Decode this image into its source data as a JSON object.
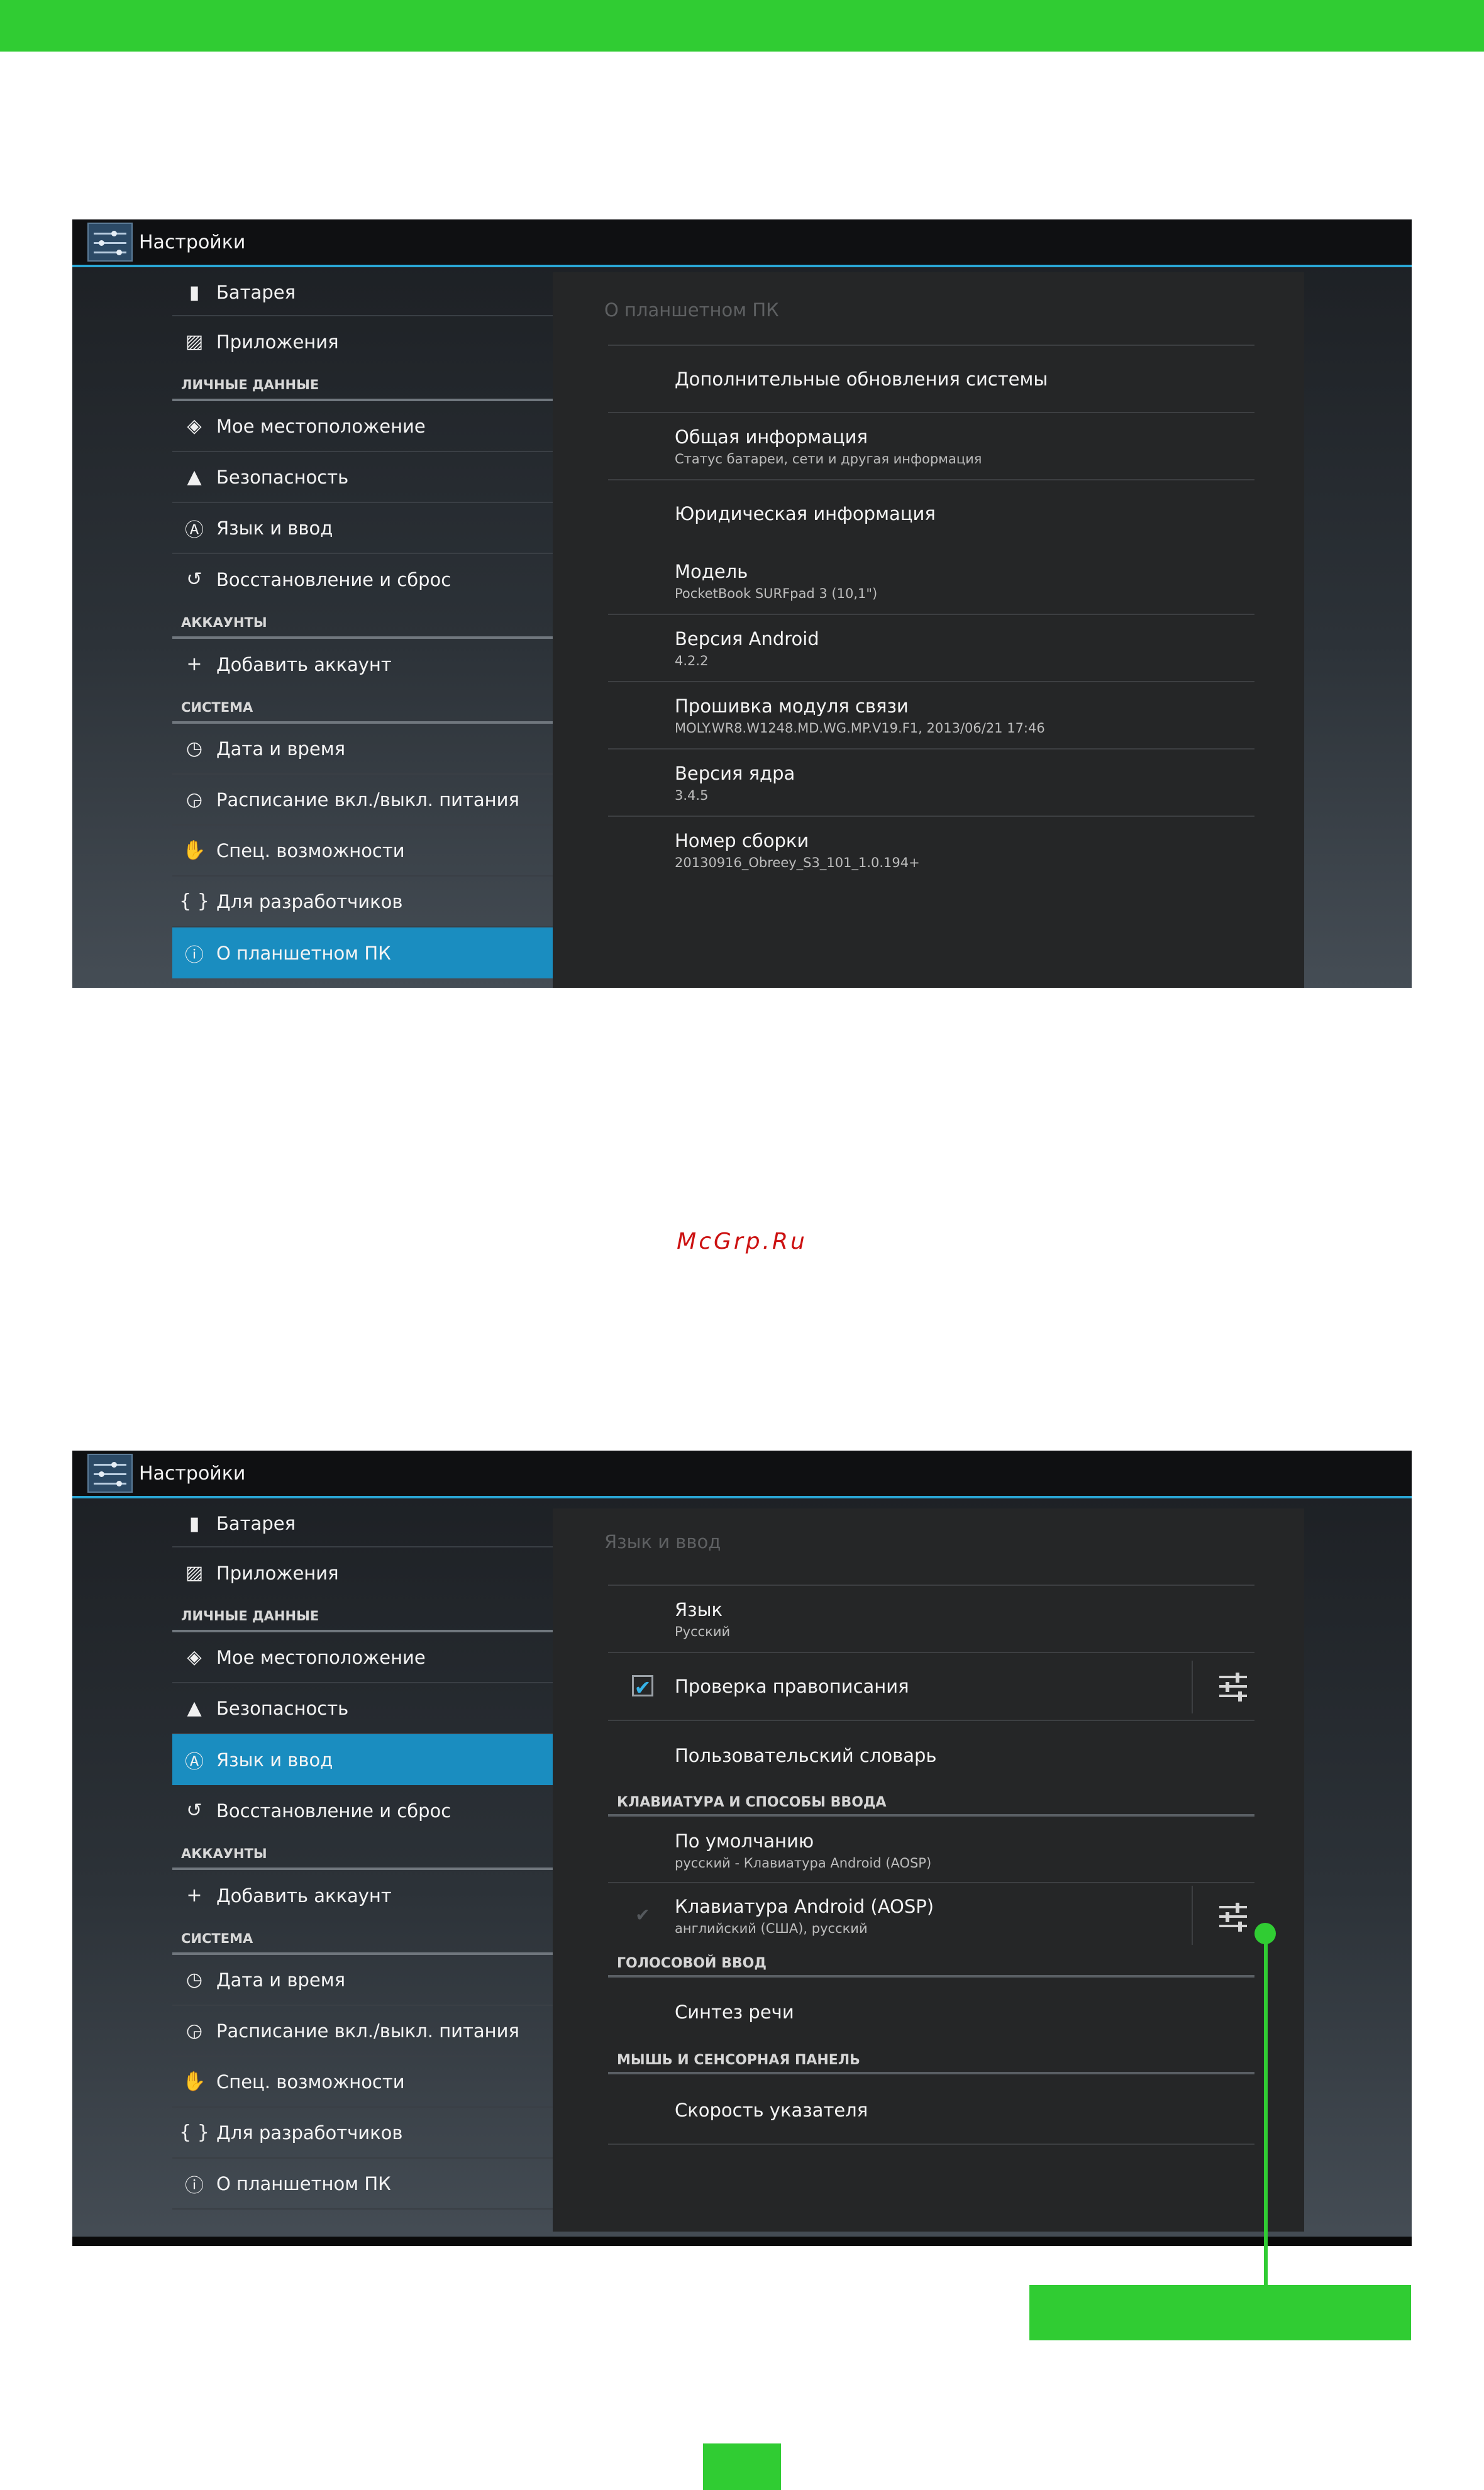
{
  "colors": {
    "accent_green": "#30cc33",
    "holo_blue": "#2aa7d6",
    "active_item": "#1a8dc0",
    "watermark": "#cc1111"
  },
  "watermark": "McGrp.Ru",
  "screen1": {
    "app_title": "Настройки",
    "sidebar": {
      "battery": "Батарея",
      "apps": "Приложения",
      "personal_header": "ЛИЧНЫЕ ДАННЫЕ",
      "location": "Мое местоположение",
      "security": "Безопасность",
      "language": "Язык и ввод",
      "backup": "Восстановление и сброс",
      "accounts_header": "АККАУНТЫ",
      "add_account": "Добавить аккаунт",
      "system_header": "СИСТЕМА",
      "datetime": "Дата и время",
      "schedule": "Расписание вкл./выкл. питания",
      "accessibility": "Спец. возможности",
      "developer": "Для разработчиков",
      "about": "О планшетном ПК",
      "active_item": "О планшетном ПК"
    },
    "panel": {
      "title": "О планшетном ПК",
      "rows": [
        {
          "title": "Дополнительные обновления системы",
          "subtitle": ""
        },
        {
          "title": "Общая информация",
          "subtitle": "Статус батареи, сети и другая информация"
        },
        {
          "title": "Юридическая информация",
          "subtitle": ""
        },
        {
          "title": "Модель",
          "subtitle": "PocketBook SURFpad 3 (10,1\")"
        },
        {
          "title": "Версия Android",
          "subtitle": "4.2.2"
        },
        {
          "title": "Прошивка модуля связи",
          "subtitle": "MOLY.WR8.W1248.MD.WG.MP.V19.F1, 2013/06/21 17:46"
        },
        {
          "title": "Версия ядра",
          "subtitle": "3.4.5"
        },
        {
          "title": "Номер сборки",
          "subtitle": "20130916_Obreey_S3_101_1.0.194+"
        }
      ]
    }
  },
  "screen2": {
    "app_title": "Настройки",
    "sidebar": {
      "battery": "Батарея",
      "apps": "Приложения",
      "personal_header": "ЛИЧНЫЕ ДАННЫЕ",
      "location": "Мое местоположение",
      "security": "Безопасность",
      "language": "Язык и ввод",
      "backup": "Восстановление и сброс",
      "accounts_header": "АККАУНТЫ",
      "add_account": "Добавить аккаунт",
      "system_header": "СИСТЕМА",
      "datetime": "Дата и время",
      "schedule": "Расписание вкл./выкл. питания",
      "accessibility": "Спец. возможности",
      "developer": "Для разработчиков",
      "about": "О планшетном ПК",
      "active_item": "Язык и ввод"
    },
    "panel": {
      "title": "Язык и ввод",
      "language": {
        "title": "Язык",
        "subtitle": "Русский"
      },
      "spellcheck": {
        "title": "Проверка правописания",
        "checked": true
      },
      "dictionary": {
        "title": "Пользовательский словарь"
      },
      "keyboard_header": "КЛАВИАТУРА И СПОСОБЫ ВВОДА",
      "default": {
        "title": "По умолчанию",
        "subtitle": "русский - Клавиатура Android (AOSP)"
      },
      "aosp": {
        "title": "Клавиатура Android (AOSP)",
        "subtitle": "английский (США), русский",
        "checked": true
      },
      "voice_header": "ГОЛОСОВОЙ ВВОД",
      "tts": {
        "title": "Синтез речи"
      },
      "pointer_header": "МЫШЬ И СЕНСОРНАЯ ПАНЕЛЬ",
      "pointer_speed": {
        "title": "Скорость указателя"
      }
    }
  }
}
